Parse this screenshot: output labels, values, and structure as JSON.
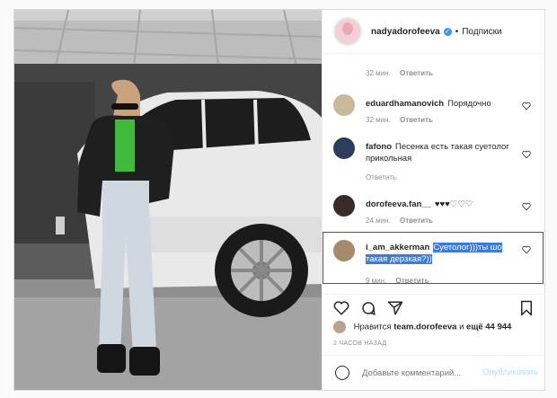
{
  "header": {
    "username": "nadyadorofeeva",
    "dot": "•",
    "follow_label": "Подписки"
  },
  "comments": [
    {
      "username": "",
      "text": "",
      "time": "32 мин.",
      "reply": "Ответить"
    },
    {
      "username": "eduardhamanovich",
      "text": "Порядочно",
      "time": "32 мин.",
      "reply": "Ответить"
    },
    {
      "username": "fafono",
      "text": "Песенка есть такая суетолог прикольная",
      "time": "Ответить",
      "reply": ""
    },
    {
      "username": "dorofeeva.fan__",
      "text": "♥♥♥♡♡♡",
      "time": "24 мин.",
      "reply": "Ответить"
    },
    {
      "username": "i_am_akkerman",
      "text": "Суетолог)))ты шо такая дерзкая?))",
      "time": "9 мин.",
      "reply": "Ответить"
    }
  ],
  "likes": {
    "prefix": "Нравится",
    "user": "team.dorofeeva",
    "and": "и",
    "more": "ещё 44 944"
  },
  "timestamp": "2 ЧАСОВ НАЗАД",
  "add_comment": {
    "placeholder": "Добавьте комментарий...",
    "publish_label": "Опубликовать"
  },
  "colors": {
    "accent": "#3897f0",
    "selection": "#3c7bd6",
    "muted": "#8e8e8e"
  }
}
